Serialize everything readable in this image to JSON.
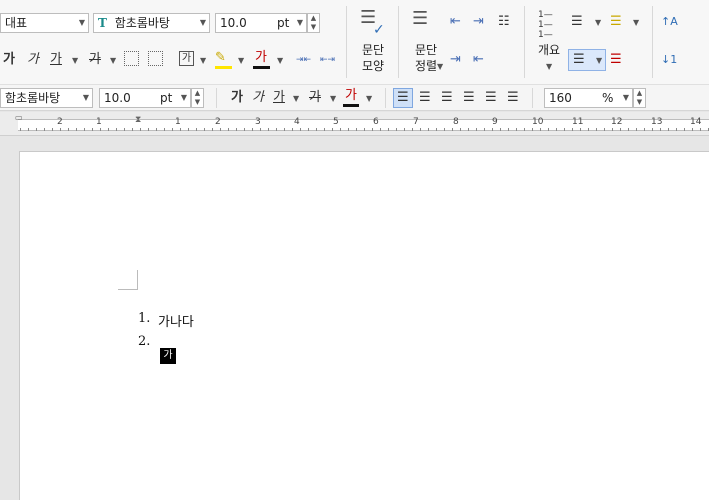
{
  "ribbon": {
    "style_combo": "대표",
    "font_combo": "함초롬바탕",
    "size_combo": {
      "value": "10.0",
      "unit": "pt"
    },
    "char_buttons": [
      "가",
      "가",
      "가",
      "가"
    ],
    "highlight_label": "가",
    "fontcolor_label": "가",
    "para_shape_label": [
      "문단",
      "모양"
    ],
    "para_align_label": [
      "문단",
      "정렬"
    ],
    "outline_label": "개요"
  },
  "format_bar": {
    "font_combo": "함초롬바탕",
    "size_combo": {
      "value": "10.0",
      "unit": "pt"
    },
    "char_buttons": [
      "가",
      "가",
      "가",
      "가",
      "가"
    ],
    "linespacing_combo": {
      "value": "160",
      "unit": "%"
    }
  },
  "ruler": {
    "numbers": [
      "2",
      "1",
      "1",
      "2",
      "3",
      "4",
      "5",
      "6",
      "7",
      "8",
      "9",
      "10",
      "11",
      "12",
      "13",
      "14"
    ]
  },
  "document": {
    "items": [
      {
        "number": "1.",
        "text": "가나다"
      },
      {
        "number": "2.",
        "text": ""
      }
    ],
    "cursor_char": "가"
  }
}
